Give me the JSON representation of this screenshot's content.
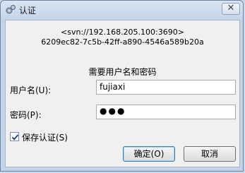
{
  "window": {
    "title": "认证",
    "close_glyph": "✕"
  },
  "auth": {
    "realm": "<svn://192.168.205.100:3690>",
    "repo_uuid": "6209ec82-7c5b-42ff-a890-4546a589b20a",
    "prompt": "需要用户名和密码"
  },
  "fields": {
    "username_label": "用户名(U):",
    "username_value": "fujiaxi",
    "password_label": "密码(P):",
    "password_mask": "●●●"
  },
  "options": {
    "save_auth_label": "保存认证(S)",
    "save_auth_checked": true
  },
  "buttons": {
    "ok_label": "确定(O)",
    "cancel_label": "取消"
  },
  "icons": {
    "app": "gears-icon",
    "close": "close-icon",
    "check": "checkmark-icon"
  }
}
